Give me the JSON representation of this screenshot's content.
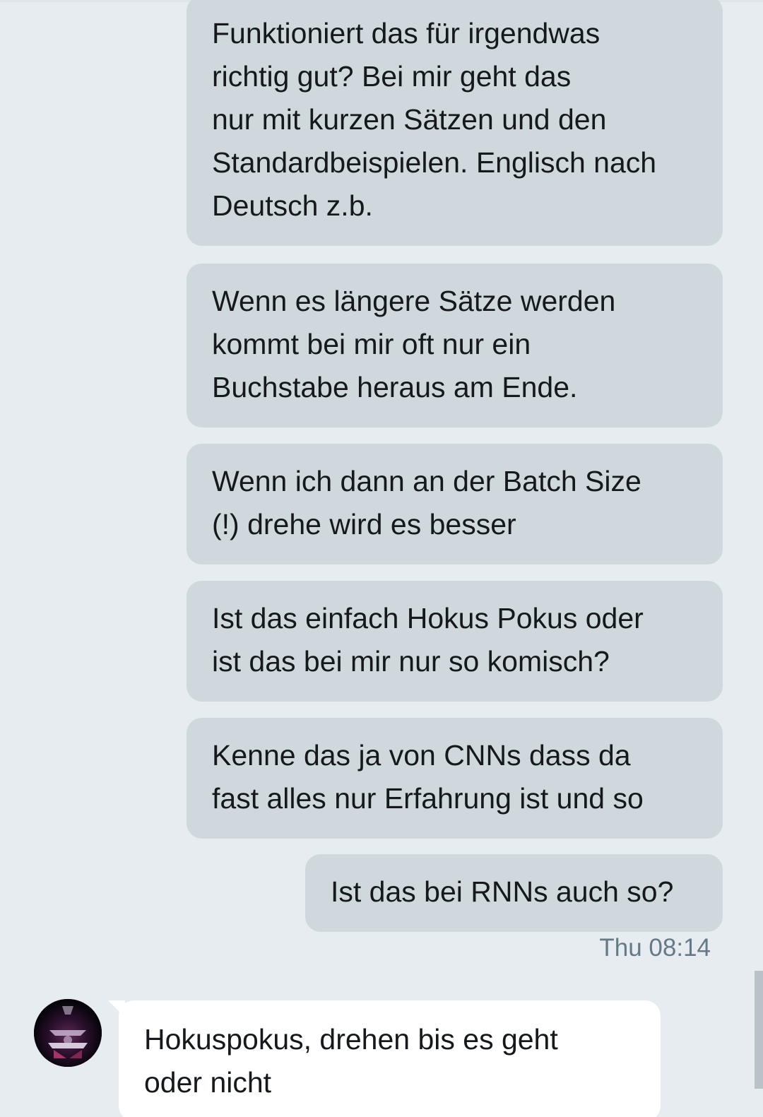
{
  "messages": [
    {
      "id": "m1",
      "direction": "outgoing",
      "text": "Funktioniert das für irgendwas\nrichtig gut? Bei mir geht das\nnur mit kurzen Sätzen und den\nStandardbeispielen. Englisch nach\nDeutsch z.b."
    },
    {
      "id": "m2",
      "direction": "outgoing",
      "text": "Wenn es längere Sätze werden\nkommt bei mir oft nur ein\nBuchstabe heraus am Ende."
    },
    {
      "id": "m3",
      "direction": "outgoing",
      "text": "Wenn ich dann an der Batch Size\n(!) drehe wird es besser"
    },
    {
      "id": "m4",
      "direction": "outgoing",
      "text": "Ist das einfach Hokus Pokus oder\nist das bei mir nur so komisch?"
    },
    {
      "id": "m5",
      "direction": "outgoing",
      "text": "Kenne das ja von CNNs dass da\nfast alles nur Erfahrung ist und so"
    },
    {
      "id": "m6",
      "direction": "outgoing",
      "text": "Ist das bei RNNs auch so?"
    },
    {
      "id": "m7",
      "direction": "incoming",
      "text": "Hokuspokus, drehen bis es geht\noder nicht"
    }
  ],
  "timestamp": "Thu 08:14",
  "avatar": {
    "icon": "user-avatar-icon"
  },
  "colors": {
    "background": "#e6ecf0",
    "outgoing_bubble": "#cfd8dc",
    "incoming_bubble": "#ffffff",
    "text": "#15191d",
    "timestamp": "#657a86"
  }
}
